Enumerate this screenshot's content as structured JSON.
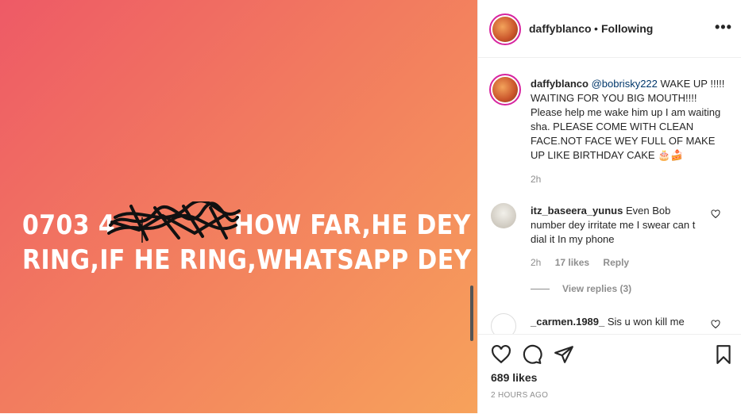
{
  "media": {
    "line1_pre": "0703 4",
    "line1_post": "HOW FAR,HE DEY",
    "line2": "RING,IF HE  RING,WHATSAPP DEY O"
  },
  "header": {
    "username": "daffyblanco",
    "separator": "•",
    "follow_status": "Following",
    "more": "•••"
  },
  "caption": {
    "username": "daffyblanco",
    "mention": "@bobrisky222",
    "text": " WAKE UP !!!!! WAITING FOR YOU BIG MOUTH!!!! Please help me wake him up I am waiting sha. PLEASE COME WITH CLEAN FACE.NOT FACE WEY FULL OF MAKE UP LIKE BIRTHDAY CAKE 🎂🍰",
    "time": "2h"
  },
  "comments": [
    {
      "username": "itz_baseera_yunus",
      "text": " Even Bob number dey irritate me I swear can t dial it In my phone",
      "time": "2h",
      "likes": "17 likes",
      "reply": "Reply",
      "view_replies": "View replies (3)"
    },
    {
      "username": "_carmen.1989_",
      "text": " Sis u won kill me"
    }
  ],
  "footer": {
    "likes": "689 likes",
    "posted": "2 HOURS AGO"
  }
}
